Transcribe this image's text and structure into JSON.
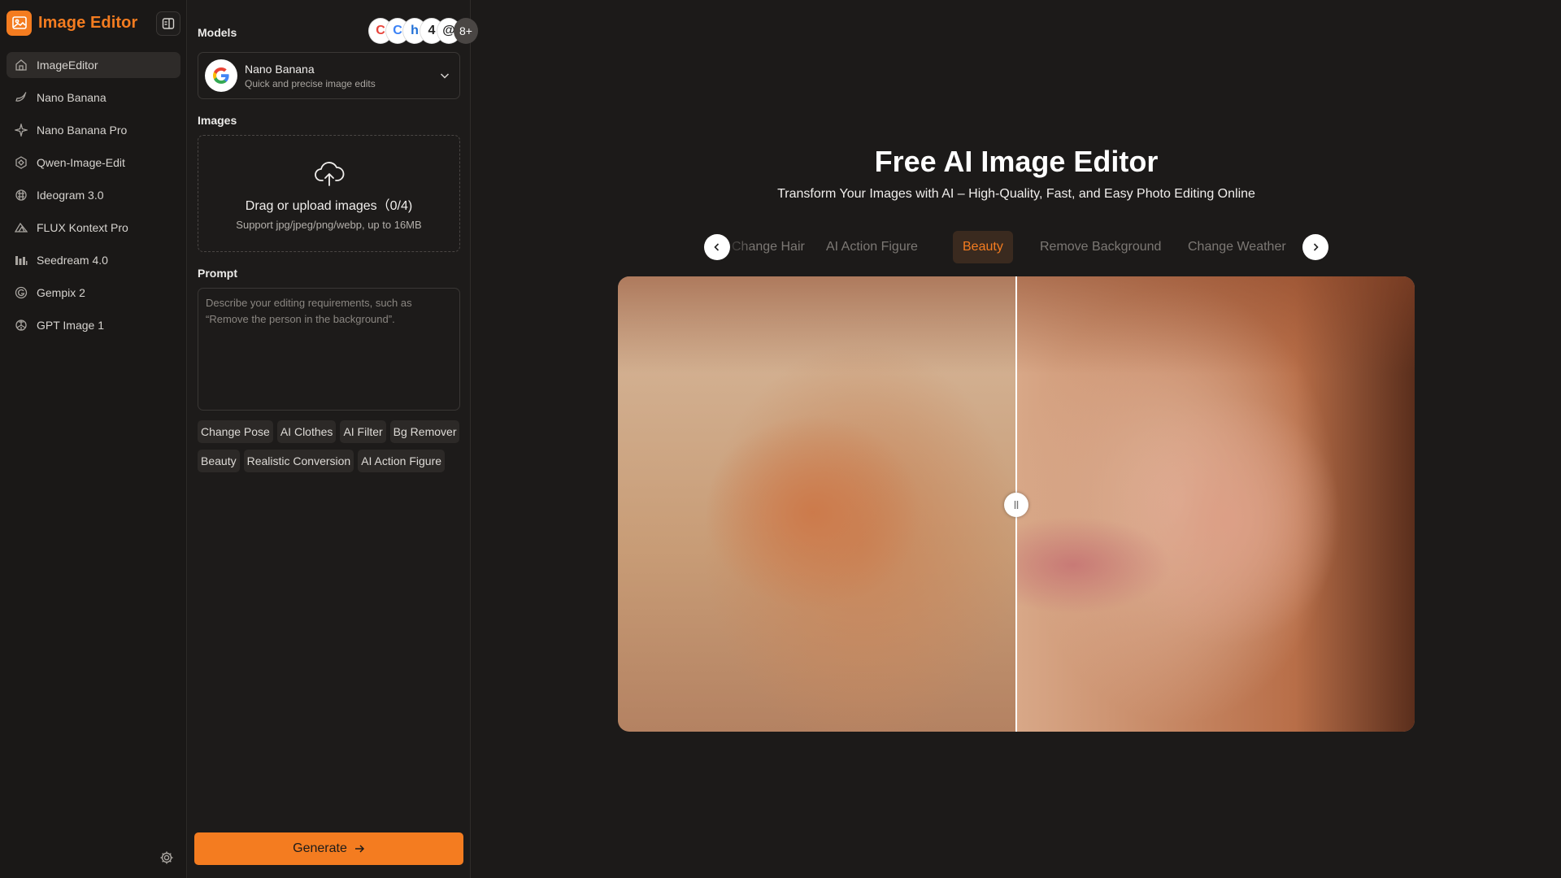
{
  "app": {
    "title": "Image Editor",
    "brand_color": "#f47c20"
  },
  "sidebar": {
    "items": [
      {
        "label": "ImageEditor",
        "icon": "home-icon",
        "active": true
      },
      {
        "label": "Nano Banana",
        "icon": "banana-icon"
      },
      {
        "label": "Nano Banana Pro",
        "icon": "sparkle-icon"
      },
      {
        "label": "Qwen-Image-Edit",
        "icon": "qwen-icon"
      },
      {
        "label": "Ideogram 3.0",
        "icon": "ideogram-icon"
      },
      {
        "label": "FLUX Kontext Pro",
        "icon": "flux-icon"
      },
      {
        "label": "Seedream 4.0",
        "icon": "bars-icon"
      },
      {
        "label": "Gempix 2",
        "icon": "gempix-icon"
      },
      {
        "label": "GPT Image 1",
        "icon": "openai-icon"
      }
    ]
  },
  "panel": {
    "models_label": "Models",
    "models_more": "8+",
    "model_avatar_glyphs": [
      "C",
      "C",
      "h",
      "4",
      "@"
    ],
    "selected_model": {
      "name": "Nano Banana",
      "description": "Quick and precise image edits"
    },
    "images_label": "Images",
    "upload_title": "Drag or upload images（0/4)",
    "upload_sub": "Support jpg/jpeg/png/webp, up to 16MB",
    "prompt_label": "Prompt",
    "prompt_placeholder": "Describe your editing requirements, such as “Remove the person in the background”.",
    "prompt_value": "",
    "chips": [
      "Change Pose",
      "AI Clothes",
      "AI Filter",
      "Bg Remover",
      "Beauty",
      "Realistic Conversion",
      "AI Action Figure"
    ],
    "generate_label": "Generate"
  },
  "main": {
    "title": "Free AI Image Editor",
    "subtitle": "Transform Your Images with AI – High-Quality, Fast, and Easy Photo Editing Online",
    "tabs": [
      {
        "label": "Change Hair"
      },
      {
        "label": "AI Action Figure"
      },
      {
        "label": "Beauty",
        "active": true
      },
      {
        "label": "Remove Background"
      },
      {
        "label": "Change Weather"
      }
    ],
    "compare_split": 0.5
  }
}
